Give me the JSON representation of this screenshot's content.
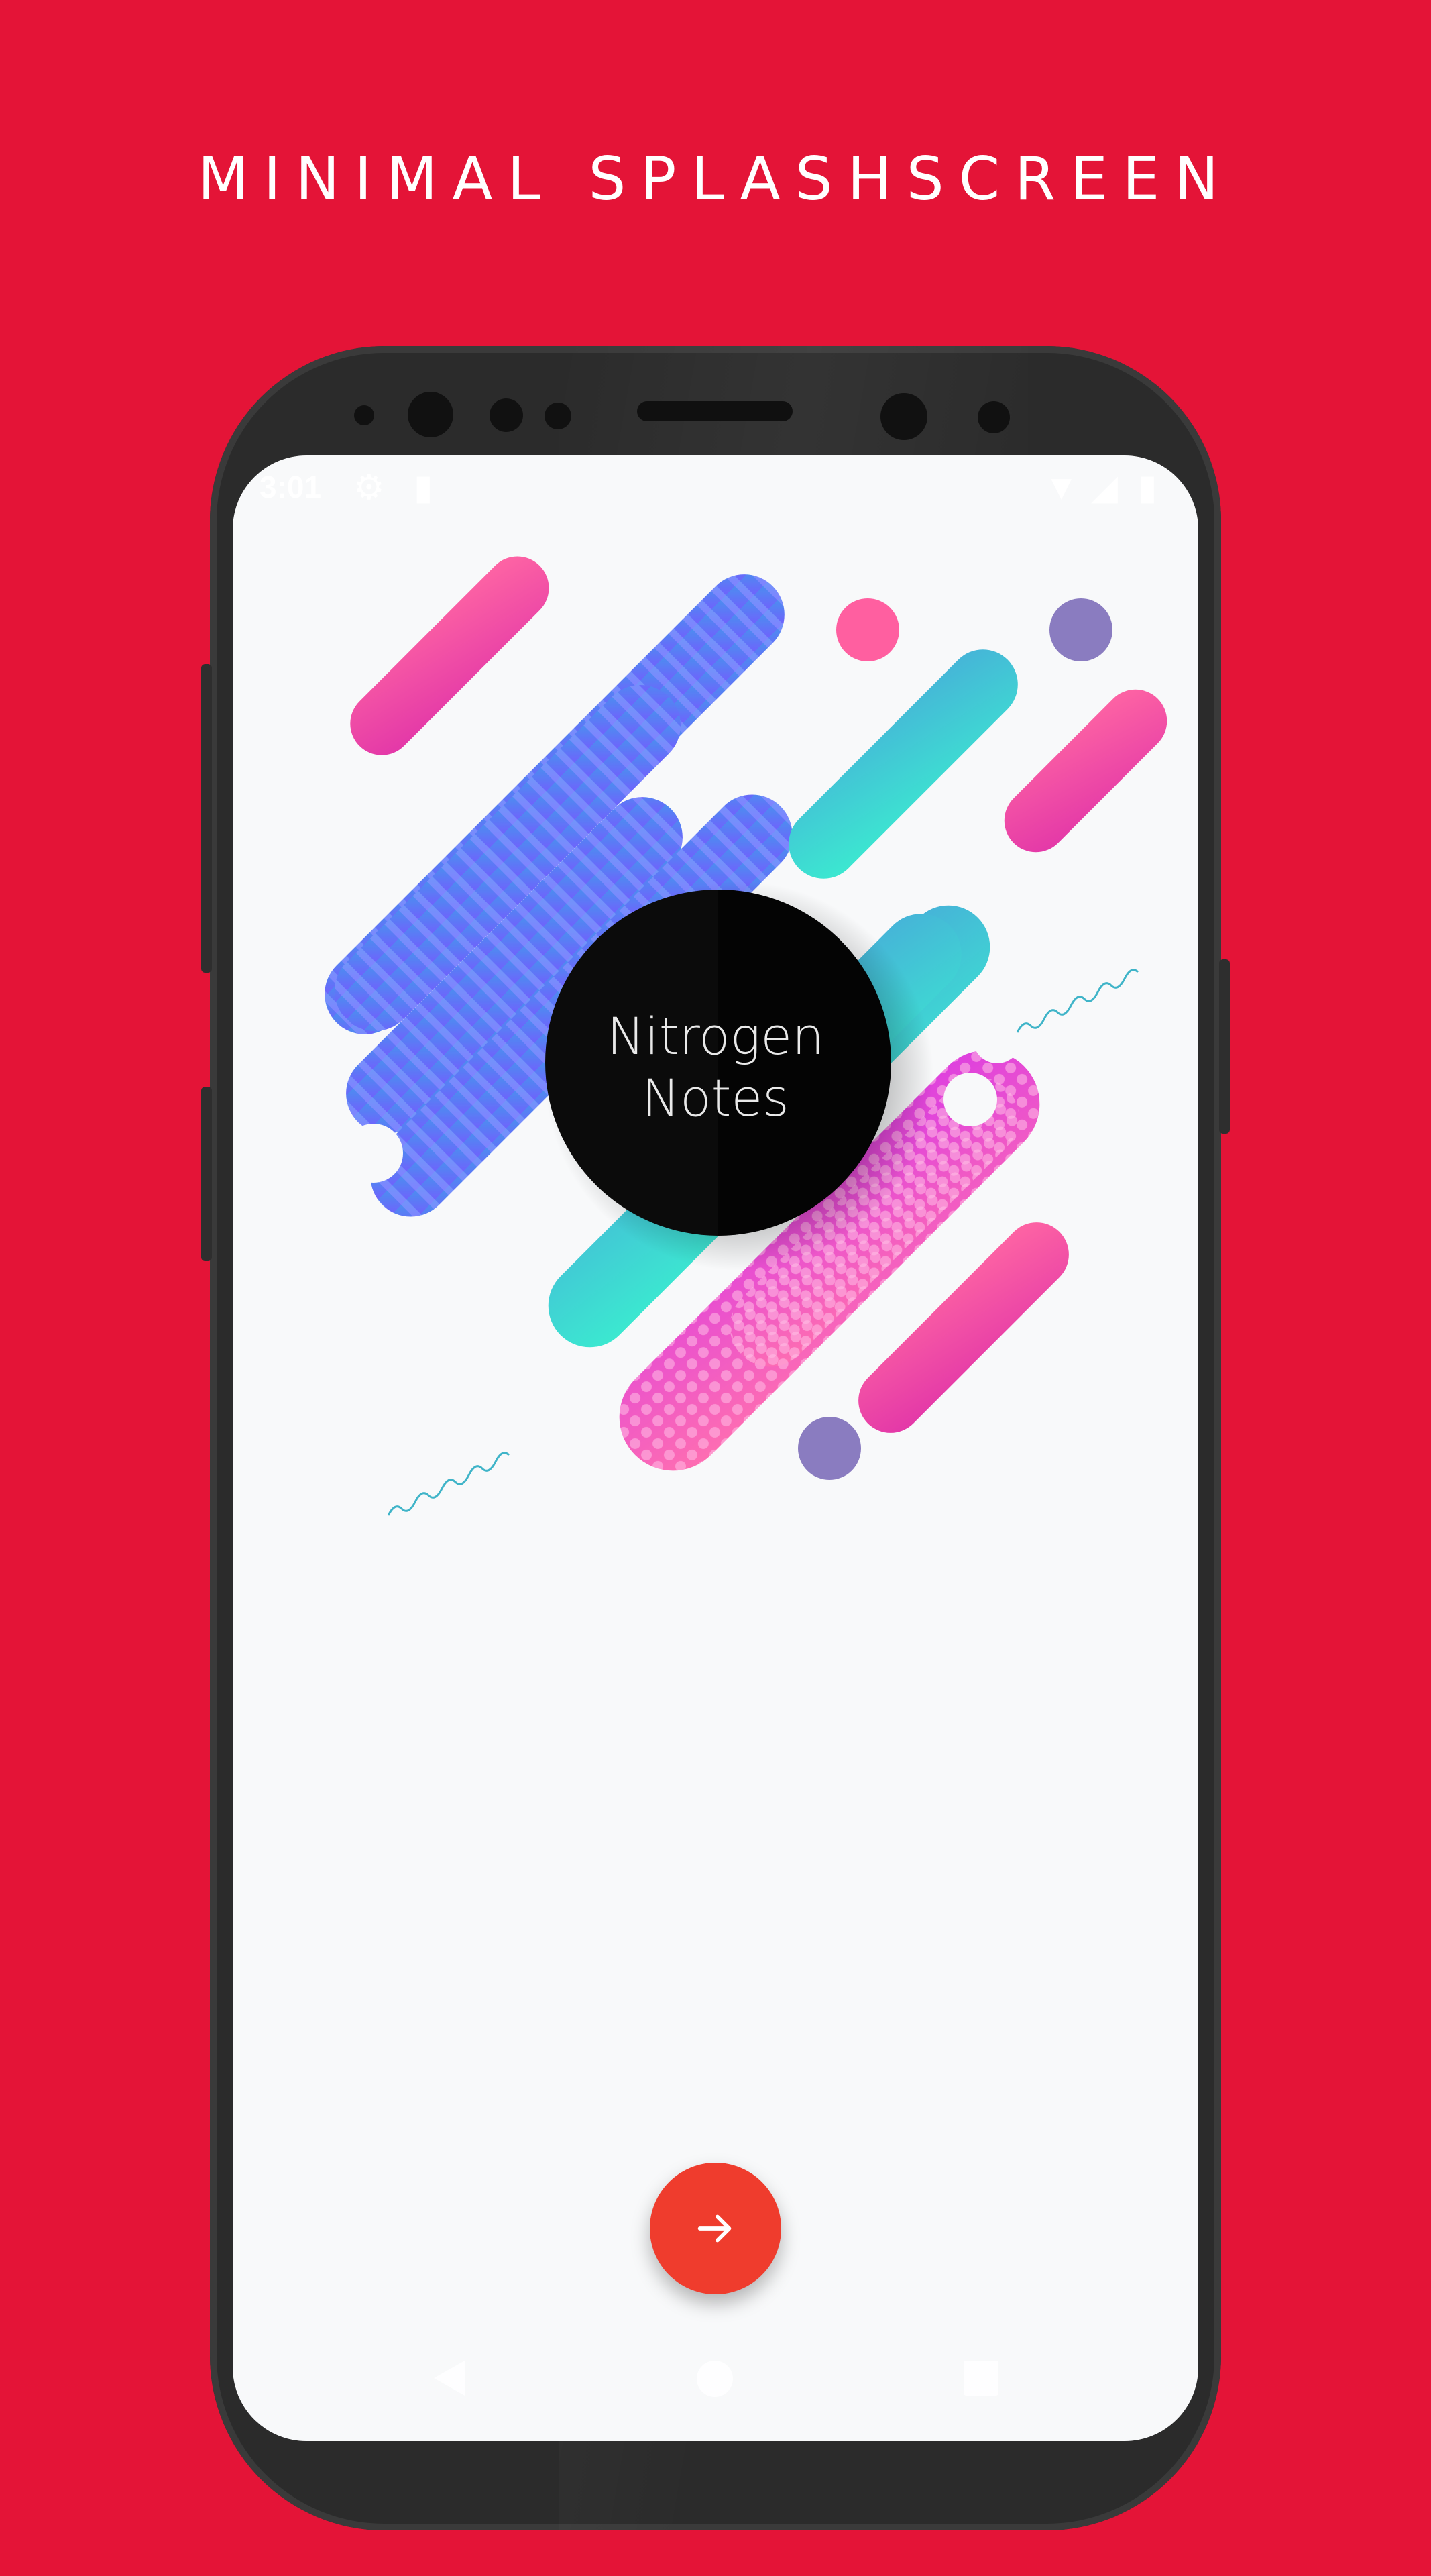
{
  "headline": "MINIMAL SPLASHSCREEN",
  "status_bar": {
    "time": "3:01",
    "icons": [
      "settings-icon",
      "sd-card-icon",
      "wifi-icon",
      "signal-icon",
      "battery-icon"
    ]
  },
  "app": {
    "name_line1": "Nitrogen",
    "name_line2": "Notes"
  },
  "fab": {
    "icon": "arrow-right-icon"
  },
  "navigation": [
    "back-icon",
    "home-icon",
    "recents-icon"
  ],
  "colors": {
    "background": "#E41437",
    "fab": "#EF3C2D",
    "phone_body": "#2B2B2B",
    "screen": "#F8F9FA",
    "logo_circle": "#0B0B0B"
  }
}
